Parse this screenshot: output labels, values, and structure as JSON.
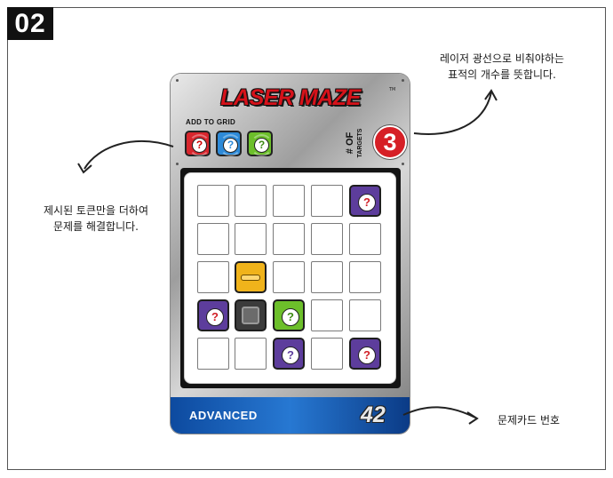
{
  "step_badge": "02",
  "card": {
    "title": "LASER MAZE",
    "trademark": "TM",
    "add_to_grid_label": "ADD TO GRID",
    "add_to_grid_tokens": [
      {
        "color": "red",
        "symbol": "?"
      },
      {
        "color": "blue",
        "symbol": "?"
      },
      {
        "color": "green",
        "symbol": "?"
      }
    ],
    "targets_label_line1": "# OF",
    "targets_label_line2": "TARGETS",
    "targets_count": "3",
    "grid": {
      "rows": 5,
      "cols": 5,
      "pieces": [
        {
          "row": 1,
          "col": 5,
          "type": "purple-target",
          "symbol": "?"
        },
        {
          "row": 3,
          "col": 2,
          "type": "beam-splitter"
        },
        {
          "row": 4,
          "col": 1,
          "type": "purple-target",
          "symbol": "?"
        },
        {
          "row": 4,
          "col": 2,
          "type": "blocker"
        },
        {
          "row": 4,
          "col": 3,
          "type": "green-mirror",
          "symbol": "?"
        },
        {
          "row": 5,
          "col": 3,
          "type": "purple-unknown",
          "symbol": "?"
        },
        {
          "row": 5,
          "col": 5,
          "type": "purple-target",
          "symbol": "?"
        }
      ]
    },
    "difficulty": "ADVANCED",
    "card_number": "42"
  },
  "annotations": {
    "targets_note_line1": "레이저 광선으로 비춰야하는",
    "targets_note_line2": "표적의 개수를 뜻합니다.",
    "tokens_note_line1": "제시된 토큰만을 더하여",
    "tokens_note_line2": "문제를 해결합니다.",
    "number_note": "문제카드 번호"
  },
  "colors": {
    "red": "#d8262d",
    "blue": "#2d8ad8",
    "green": "#6cbf2a",
    "purple": "#5d3d9c",
    "footer_blue": "#1a63bf"
  }
}
